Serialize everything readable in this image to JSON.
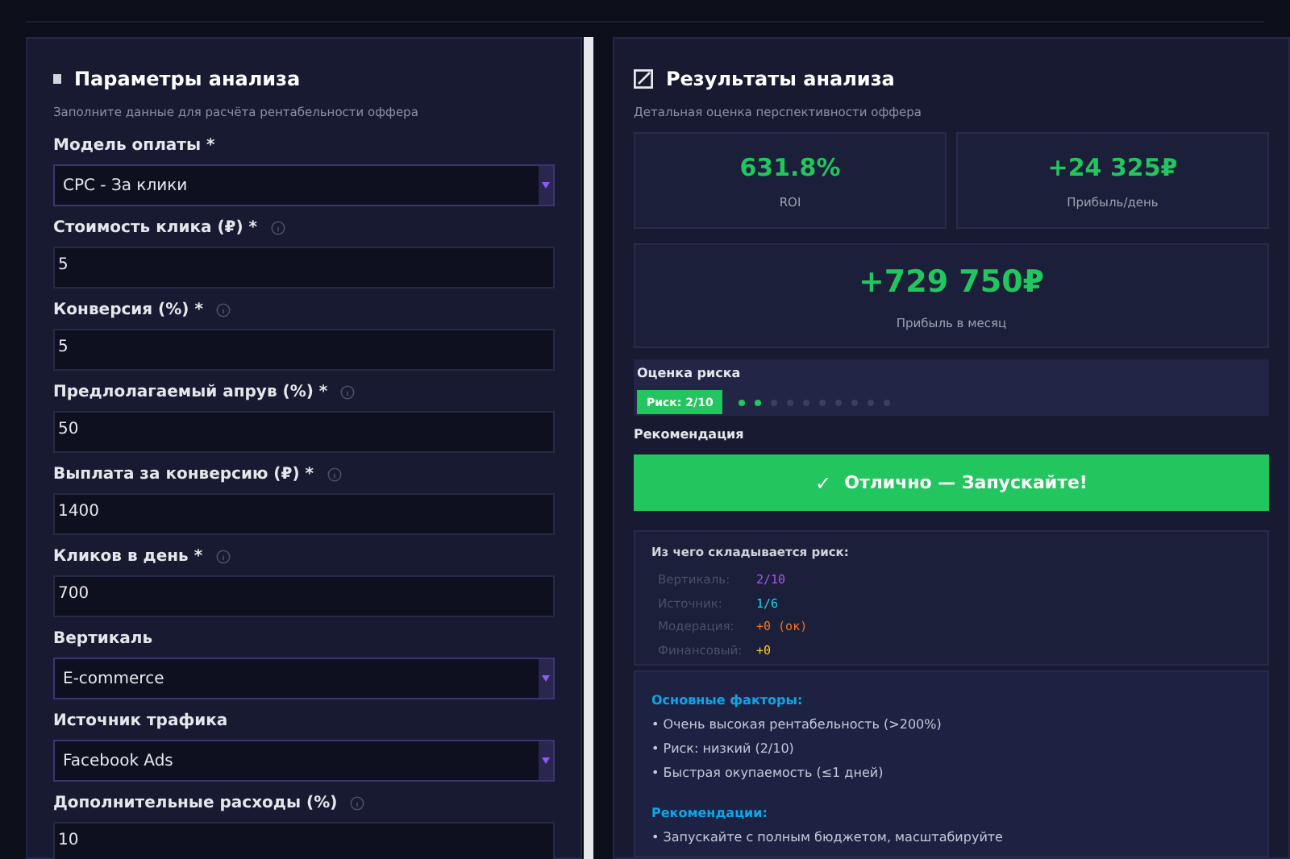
{
  "params": {
    "title": "Параметры анализа",
    "subtitle": "Заполните данные для расчёта рентабельности оффера",
    "fields": [
      {
        "kind": "select",
        "label": "Модель оплаты *",
        "info": false,
        "value": "CPC - За клики"
      },
      {
        "kind": "input",
        "label": "Стоимость клика (₽) *",
        "info": true,
        "value": "5"
      },
      {
        "kind": "input",
        "label": "Конверсия (%) *",
        "info": true,
        "value": "5"
      },
      {
        "kind": "input",
        "label": "Предлолагаемый апрув (%) *",
        "info": true,
        "value": "50"
      },
      {
        "kind": "input",
        "label": "Выплата за конверсию (₽) *",
        "info": true,
        "value": "1400"
      },
      {
        "kind": "input",
        "label": "Кликов в день *",
        "info": true,
        "value": "700"
      },
      {
        "kind": "select",
        "label": "Вертикаль",
        "info": false,
        "value": "E-commerce"
      },
      {
        "kind": "select",
        "label": "Источник трафика",
        "info": false,
        "value": "Facebook Ads"
      },
      {
        "kind": "input",
        "label": "Дополнительные расходы (%)",
        "info": true,
        "value": "10"
      }
    ]
  },
  "results": {
    "title": "Результаты анализа",
    "subtitle": "Детальная оценка перспективности оффера",
    "stats": [
      {
        "value": "631.8%",
        "label": "ROI"
      },
      {
        "value": "+24 325₽",
        "label": "Прибыль/день"
      }
    ],
    "month": {
      "value": "+729 750₽",
      "label": "Прибыль в месяц"
    },
    "risk": {
      "title": "Оценка риска",
      "badge": "Риск: 2/10",
      "dots": [
        {
          "on": true
        },
        {
          "on": true
        },
        {
          "on": false
        },
        {
          "on": false
        },
        {
          "on": false
        },
        {
          "on": false
        },
        {
          "on": false
        },
        {
          "on": false
        },
        {
          "on": false
        },
        {
          "on": false
        }
      ]
    },
    "recommendation": {
      "title": "Рекомендация",
      "icon": "✓",
      "text": "Отлично — Запускайте!"
    },
    "breakdown": {
      "title": "Из чего складывается риск:",
      "rows": [
        {
          "label": "Вертикаль:",
          "value": "2/10",
          "color": "#a855f7"
        },
        {
          "label": "Источник:",
          "value": "1/6",
          "color": "#22d3ee"
        },
        {
          "label": "Модерация:",
          "value": "+0 (ок)",
          "color": "#f97316"
        },
        {
          "label": "Финансовый:",
          "value": "+0",
          "color": "#facc15"
        }
      ]
    },
    "factors": {
      "title": "Основные факторы:",
      "items": [
        "• Очень высокая рентабельность (>200%)",
        "• Риск: низкий (2/10)",
        "• Быстрая окупаемость (≤1 дней)"
      ]
    },
    "advice": {
      "title": "Рекомендации:",
      "items": [
        "• Запускайте с полным бюджетом, масштабируйте"
      ]
    }
  }
}
